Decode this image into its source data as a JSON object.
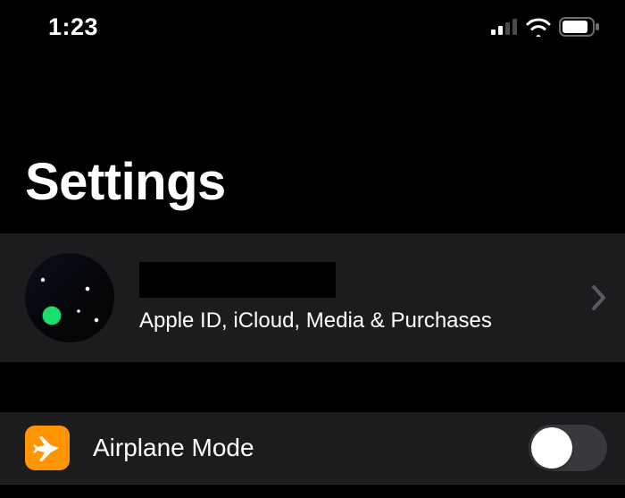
{
  "status": {
    "time": "1:23",
    "cellular_bars": 2,
    "wifi": true,
    "battery_pct": 80
  },
  "page": {
    "title": "Settings"
  },
  "apple_id": {
    "name": "",
    "subtitle": "Apple ID, iCloud, Media & Purchases"
  },
  "rows": {
    "airplane": {
      "icon": "airplane",
      "label": "Airplane Mode",
      "on": false
    }
  },
  "colors": {
    "group_bg": "#1c1c1e",
    "airplane_icon_bg": "#ff9500",
    "switch_off_bg": "#39393d",
    "accent_green": "#30d158"
  }
}
